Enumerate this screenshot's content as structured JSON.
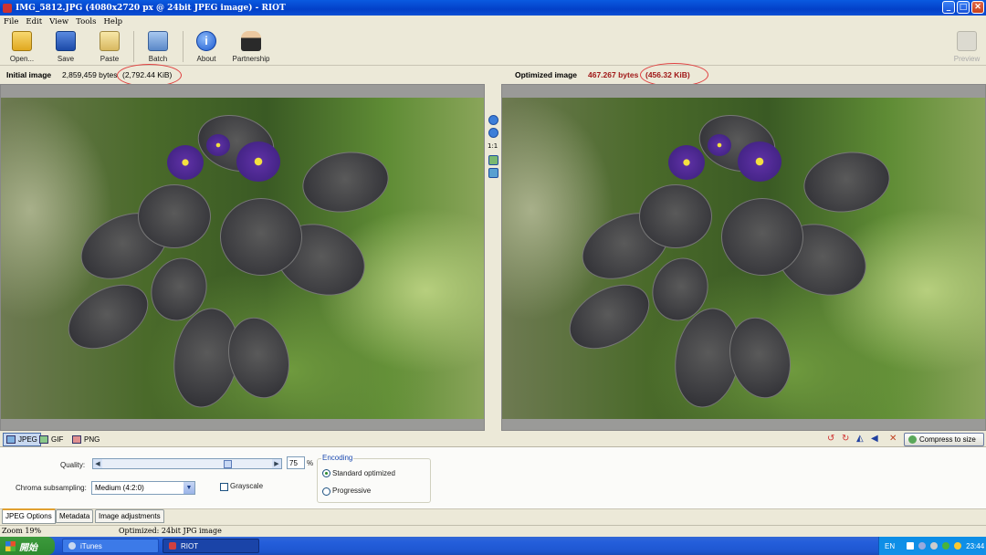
{
  "window": {
    "title": "IMG_5812.JPG (4080x2720 px @ 24bit JPEG image) - RIOT"
  },
  "menu": [
    "File",
    "Edit",
    "View",
    "Tools",
    "Help"
  ],
  "toolbar": {
    "open": "Open...",
    "save": "Save",
    "paste": "Paste",
    "batch": "Batch",
    "about": "About",
    "partnership": "Partnership",
    "preview": "Preview"
  },
  "info": {
    "initial_label": "Initial image",
    "initial_size": "2,859,459 bytes",
    "initial_kib": "(2,792.44 KiB)",
    "optimized_label": "Optimized image",
    "optimized_size": "467.267 bytes",
    "optimized_kib": "(456.32 KiB)"
  },
  "viewer": {
    "zoom_1to1": "1:1"
  },
  "formats": [
    "JPEG",
    "GIF",
    "PNG"
  ],
  "compress_to_size": "Compress to size",
  "jpeg_options": {
    "quality_label": "Quality:",
    "quality_value": "75",
    "quality_unit": "%",
    "quality_fraction": 0.75,
    "chroma_label": "Chroma subsampling:",
    "chroma_value": "Medium (4:2:0)",
    "grayscale_label": "Grayscale",
    "grayscale_checked": false,
    "encoding_title": "Encoding",
    "encoding_standard": "Standard optimized",
    "encoding_progressive": "Progressive",
    "encoding_selected": "Standard optimized"
  },
  "bottom_tabs": [
    "JPEG Options",
    "Metadata",
    "Image adjustments"
  ],
  "status": {
    "zoom": "Zoom 19%",
    "info": "Optimized: 24bit JPG image"
  },
  "taskbar": {
    "start": "開始",
    "tasks": [
      "iTunes",
      "RIOT"
    ],
    "lang": "EN",
    "clock": "23:44"
  },
  "colors": {
    "accent": "#0a5ae0",
    "optimized_text": "#a01818",
    "highlight": "#e04040"
  }
}
